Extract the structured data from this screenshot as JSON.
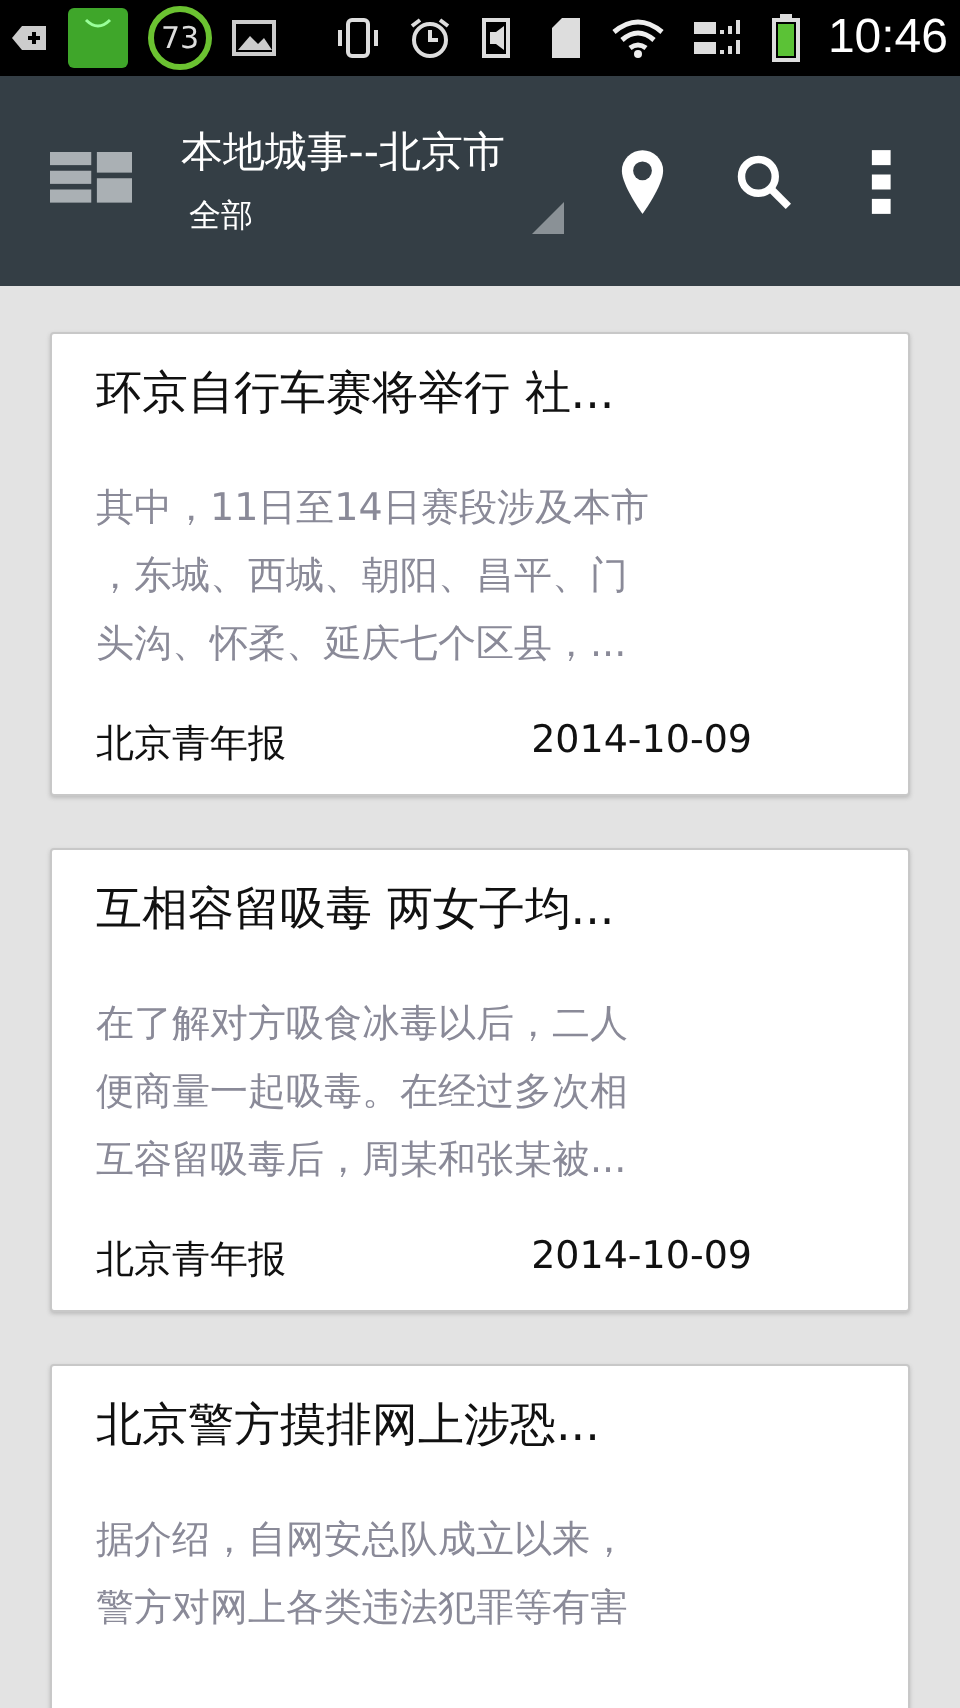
{
  "status_bar": {
    "battery_badge": "73",
    "time": "10:46"
  },
  "app_bar": {
    "title": "本地城事--北京市",
    "filter": "全部"
  },
  "articles": [
    {
      "title": "环京自行车赛将举行 社...",
      "lines": [
        "其中，11日至14日赛段涉及本市",
        "，东城、西城、朝阳、昌平、门",
        "头沟、怀柔、延庆七个区县，..."
      ],
      "source": "北京青年报",
      "date": "2014-10-09"
    },
    {
      "title": "互相容留吸毒 两女子均...",
      "lines": [
        "在了解对方吸食冰毒以后，二人",
        "便商量一起吸毒。在经过多次相",
        "互容留吸毒后，周某和张某被..."
      ],
      "source": "北京青年报",
      "date": "2014-10-09"
    },
    {
      "title": "北京警方摸排网上涉恐...",
      "lines": [
        "据介绍，自网安总队成立以来，",
        "警方对网上各类违法犯罪等有害"
      ]
    }
  ]
}
